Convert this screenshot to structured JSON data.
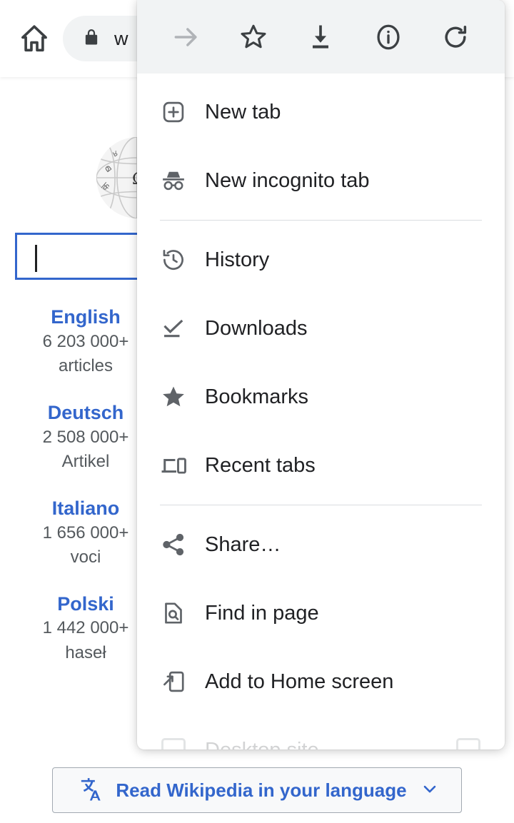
{
  "browser": {
    "home_icon": "home-icon",
    "lock_icon": "lock-icon",
    "url_text": "w"
  },
  "menu": {
    "header_icons": [
      {
        "name": "forward-icon",
        "label": "Forward",
        "disabled": true
      },
      {
        "name": "bookmark-star-icon",
        "label": "Bookmark",
        "disabled": false
      },
      {
        "name": "download-icon",
        "label": "Download",
        "disabled": false
      },
      {
        "name": "page-info-icon",
        "label": "Page info",
        "disabled": false
      },
      {
        "name": "reload-icon",
        "label": "Reload",
        "disabled": false
      }
    ],
    "items": [
      {
        "label": "New tab",
        "icon": "new-tab-icon"
      },
      {
        "label": "New incognito tab",
        "icon": "incognito-icon"
      },
      {
        "label": "History",
        "icon": "history-icon"
      },
      {
        "label": "Downloads",
        "icon": "downloads-icon"
      },
      {
        "label": "Bookmarks",
        "icon": "bookmarks-star-icon"
      },
      {
        "label": "Recent tabs",
        "icon": "recent-tabs-icon"
      },
      {
        "label": "Share…",
        "icon": "share-icon"
      },
      {
        "label": "Find in page",
        "icon": "find-in-page-icon"
      },
      {
        "label": "Add to Home screen",
        "icon": "add-to-home-screen-icon"
      },
      {
        "label": "Desktop site",
        "icon": "desktop-site-checkbox",
        "trailing": "checkbox"
      }
    ]
  },
  "wikipedia": {
    "logo_alt": "Wikipedia globe puzzle logo",
    "search_value": "",
    "languages": [
      {
        "name": "English",
        "count": "6 203 000+",
        "unit": "articles"
      },
      {
        "name": "Deutsch",
        "count": "2 508 000+",
        "unit": "Artikel"
      },
      {
        "name": "Italiano",
        "count": "1 656 000+",
        "unit": "voci"
      },
      {
        "name": "Polski",
        "count": "1 442 000+",
        "unit": "haseł"
      }
    ],
    "language_bar": {
      "icon": "translate-icon",
      "label": "Read Wikipedia in your language",
      "chevron": "chevron-down-icon"
    }
  },
  "colors": {
    "wiki_link_blue": "#3366cc",
    "menu_header_bg": "#f1f3f4",
    "icon_gray": "#5f6368",
    "text_dark": "#202124"
  }
}
